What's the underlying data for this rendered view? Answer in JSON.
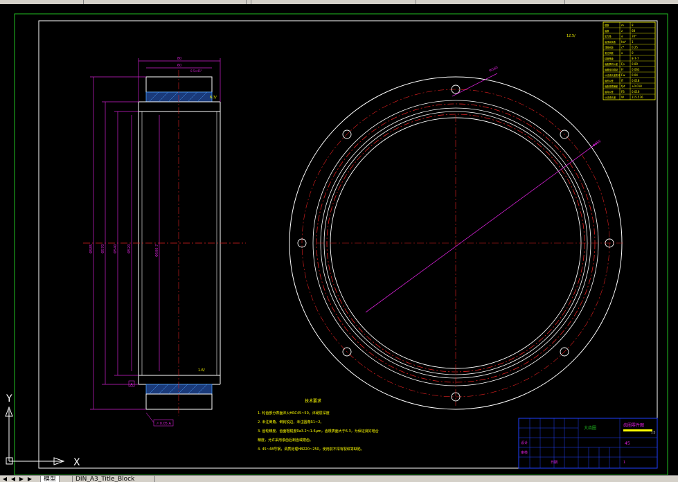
{
  "bottom_tabs": {
    "nav_buttons": [
      "◀",
      "◀",
      "▶",
      "▶"
    ],
    "tabs": [
      {
        "label": "模型",
        "active": true
      },
      {
        "label": "DIN_A3_Title_Block",
        "active": false
      }
    ]
  },
  "ucs": {
    "y_label": "Y",
    "x_label": "X"
  },
  "drawing": {
    "side_view_dims": {
      "top": "80",
      "top2": "60",
      "chamfer": "0.5×45°",
      "dia_outer": "Φ585",
      "dia_2": "Φ570",
      "dia_3": "Φ540",
      "dia_4": "Φ520",
      "dia_5": "Φ500.7",
      "gear_callout": "6.3/",
      "bottom_callout": "1.6/",
      "datum": "A",
      "tolerance_frame": "↗ 0.05 A"
    },
    "front_view_labels": {
      "top_callout": "Φ560",
      "right_callout": "Φ556",
      "roughness_note": "12.5/"
    },
    "params_table": [
      [
        "模数",
        "m",
        "8"
      ],
      [
        "齿数",
        "z",
        "68"
      ],
      [
        "压力角",
        "α",
        "20°"
      ],
      [
        "齿顶高系数",
        "ha*",
        "1"
      ],
      [
        "顶隙系数",
        "c*",
        "0.25"
      ],
      [
        "变位系数",
        "x",
        "0"
      ],
      [
        "精度等级",
        "",
        "8-7-7"
      ],
      [
        "齿距累积公差",
        "Fp",
        "0.09"
      ],
      [
        "齿圈径向跳动",
        "Fr",
        "0.063"
      ],
      [
        "公法线长度变动",
        "Fw",
        "0.04"
      ],
      [
        "齿形公差",
        "ff",
        "0.018"
      ],
      [
        "齿距极限偏差",
        "fpt",
        "±0.018"
      ],
      [
        "齿向公差",
        "Fβ",
        "0.016"
      ],
      [
        "公法线长度",
        "W",
        "115.576"
      ]
    ],
    "notes": {
      "title": "技术要求",
      "lines": [
        "1. 轮齿部分表面淬火HRC45~50，淬硬层深度",
        "2. 未注倒角、倒钝锐边，未注圆角R1~2。",
        "3. 齿轮精度、齿面粗糙度Ra3.2～1.6μm，齿根表面大于6.3，为保证良好啮合",
        "   精度，允许采用滚齿后剃齿或磨齿。",
        "4. 45~48号钢，调质处理HB220~250，使用前不得有裂纹等缺陷。"
      ]
    },
    "title_block": {
      "part_name": "大齿圈",
      "drawing_no": "齿圈零件图",
      "material": "45",
      "scale": "1:5",
      "designer": "设计",
      "checker": "审核",
      "date": "日期",
      "qty": "1"
    }
  }
}
